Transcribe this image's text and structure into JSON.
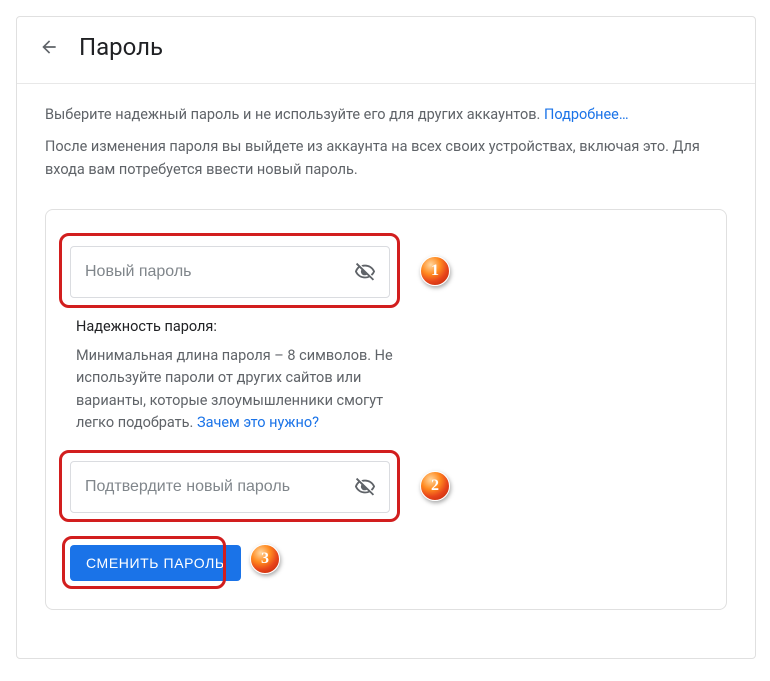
{
  "header": {
    "title": "Пароль"
  },
  "intro": {
    "line1": "Выберите надежный пароль и не используйте его для других аккаунтов. ",
    "learn_more": "Подробнее…",
    "line2": "После изменения пароля вы выйдете из аккаунта на всех своих устройствах, включая это. Для входа вам потребуется ввести новый пароль."
  },
  "fields": {
    "new_password_placeholder": "Новый пароль",
    "confirm_password_placeholder": "Подтвердите новый пароль"
  },
  "strength": {
    "title": "Надежность пароля:",
    "body": "Минимальная длина пароля – 8 символов. Не используйте пароли от других сайтов или варианты, которые злоумышленники смогут легко подобрать. ",
    "why_link": "Зачем это нужно?"
  },
  "submit": {
    "label": "СМЕНИТЬ ПАРОЛЬ"
  },
  "callouts": {
    "c1": "1",
    "c2": "2",
    "c3": "3"
  }
}
